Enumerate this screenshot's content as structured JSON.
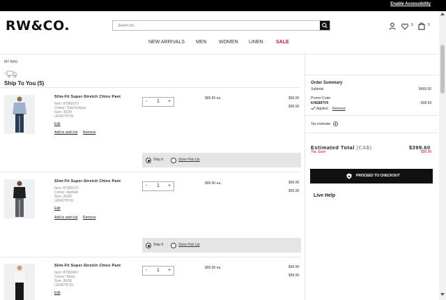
{
  "topbar": {
    "accessibility_link": "Enable Accessibility"
  },
  "header": {
    "logo": "RW&CO.",
    "search_placeholder": "Search for...",
    "wishlist_count": "0",
    "bag_count": "5"
  },
  "nav": {
    "items": [
      "NEW ARRIVALS",
      "MEN",
      "WOMEN",
      "LINEN",
      "SALE"
    ]
  },
  "breadcrumb": "MY BAG",
  "ship_section_title": "Ship To You (5)",
  "products": [
    {
      "name": "Slim-Fit Super-Stretch Chino Pant",
      "item": "Item: 87960370",
      "colour": "Colour: Total Eclipse",
      "size": "Size: 30/30",
      "length": "LENGTH:30",
      "qty": "1",
      "unit_price": "$99.90 ea.",
      "price1": "$99.90",
      "price2": "$99.90",
      "edit": "Edit",
      "wishlist": "Add to wish list",
      "remove": "Remove",
      "ship_it": "Ship It",
      "store_pickup": "Store Pick Up"
    },
    {
      "name": "Slim-Fit Super-Stretch Chino Pant",
      "item": "Item: 87960370",
      "colour": "Colour: Asphalt",
      "size": "Size: 30/30",
      "length": "LENGTH:30",
      "qty": "1",
      "unit_price": "$99.90 ea.",
      "price1": "$99.90",
      "price2": "$99.90",
      "edit": "Edit",
      "wishlist": "Add to wish list",
      "remove": "Remove",
      "ship_it": "Ship It",
      "store_pickup": "Store Pick Up"
    },
    {
      "name": "Slim-Fit Super-Stretch Chino Pant",
      "item": "Item: 87960467",
      "colour": "Colour: Black",
      "size": "Size: 30/30",
      "length": "LENGTH:30",
      "qty": "1",
      "unit_price": "$99.90 ea.",
      "price1": "$99.90",
      "price2": "$99.90",
      "edit": "Edit"
    }
  ],
  "summary": {
    "title": "Order Summary",
    "subtotal_label": "Subtotal",
    "subtotal_value": "$499.50",
    "promo_label": "Promo Code",
    "promo_code": "KHE887V9",
    "promo_value": "- $99.90",
    "applied": "Applied",
    "remove": "Remove",
    "tax_estimate": "Tax estimate",
    "estimated_total_label": "Estimated Total",
    "currency": "(CA$)",
    "estimated_total_value": "$399.60",
    "you_save_label": "You Save",
    "you_save_value": "$99.90",
    "checkout_label": "PROCEED TO CHECKOUT",
    "live_help": "Live Help"
  },
  "colors": {
    "accent": "#c8102e",
    "dark": "#111111",
    "shipbox": "#e5e5e5"
  }
}
